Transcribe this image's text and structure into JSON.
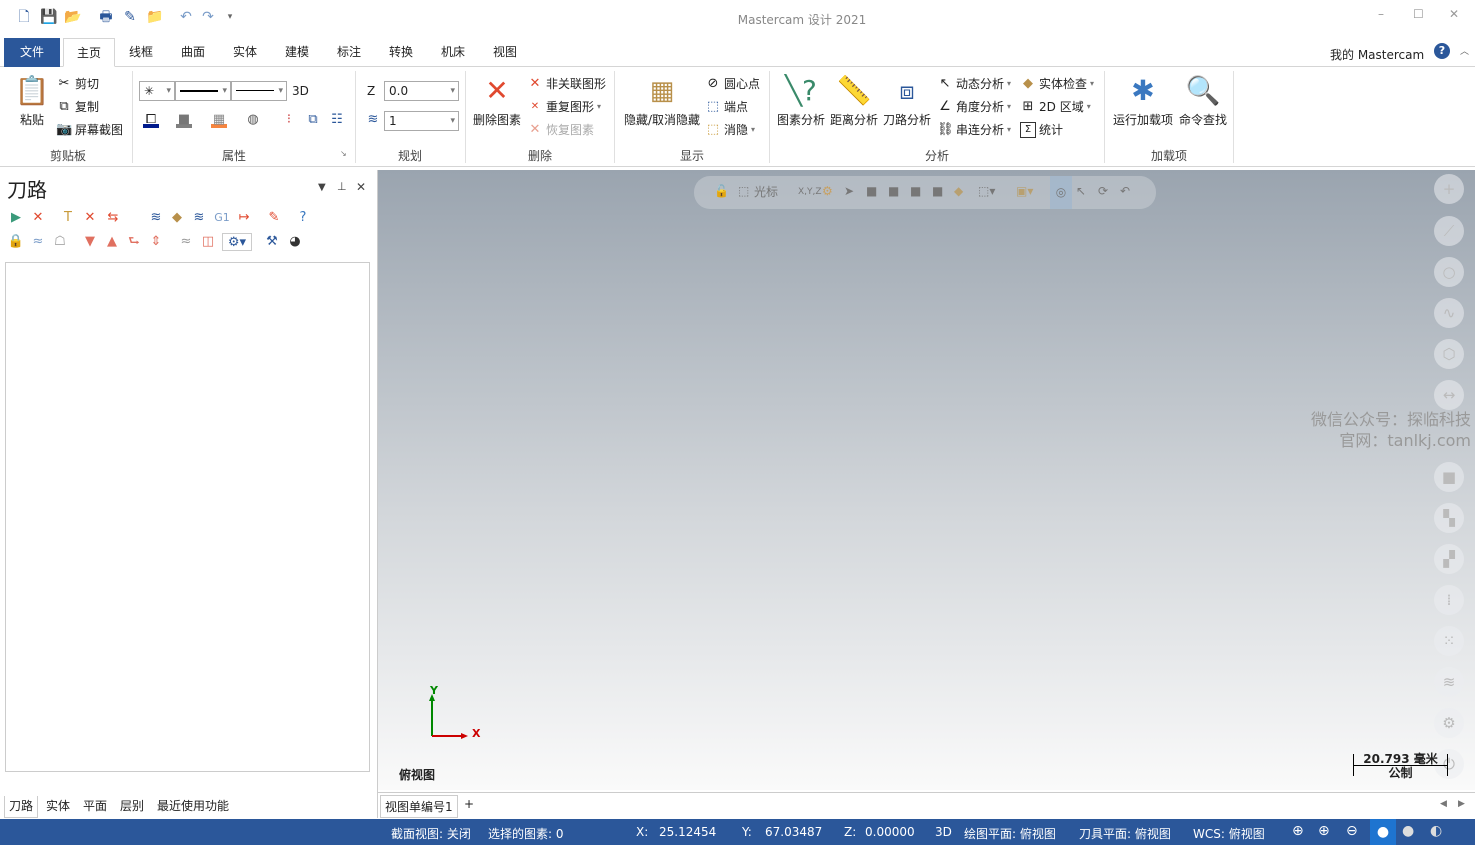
{
  "window": {
    "title": "Mastercam 设计 2021",
    "minimize": "–",
    "maximize": "☐",
    "close": "✕"
  },
  "tabs": [
    {
      "label": "文件"
    },
    {
      "label": "主页"
    },
    {
      "label": "线框"
    },
    {
      "label": "曲面"
    },
    {
      "label": "实体"
    },
    {
      "label": "建模"
    },
    {
      "label": "标注"
    },
    {
      "label": "转换"
    },
    {
      "label": "机床"
    },
    {
      "label": "视图"
    }
  ],
  "account": {
    "label": "我的 Mastercam",
    "help": "?"
  },
  "ribbon": {
    "clipboard": {
      "label": "剪贴板",
      "paste": "粘贴",
      "cut": "剪切",
      "copy": "复制",
      "screenshot": "屏幕截图"
    },
    "attributes": {
      "label": "属性",
      "point_style": "✳",
      "mode_3d": "3D"
    },
    "planning": {
      "label": "规划",
      "z_label": "Z",
      "z_value": "0.0",
      "level_value": "1"
    },
    "delete": {
      "label": "删除",
      "delete_entities": "删除图素",
      "unassociated": "非关联图形",
      "duplicate": "重复图形",
      "restore": "恢复图素"
    },
    "display": {
      "label": "显示",
      "hide_unhide": "隐藏/取消隐藏",
      "center_point": "圆心点",
      "endpoints": "端点",
      "blank": "消隐"
    },
    "analyze": {
      "label": "分析",
      "entity": "图素分析",
      "distance": "距离分析",
      "toolpath": "刀路分析",
      "dynamic": "动态分析",
      "angle": "角度分析",
      "chain": "串连分析",
      "solid_check": "实体检查",
      "area_2d": "2D 区域",
      "statistics": "统计"
    },
    "addins": {
      "label": "加载项",
      "run_addin": "运行加载项",
      "find_command": "命令查找"
    }
  },
  "panel": {
    "title": "刀路",
    "g1": "G1",
    "bottom_tabs": [
      {
        "label": "刀路"
      },
      {
        "label": "实体"
      },
      {
        "label": "平面"
      },
      {
        "label": "层别"
      },
      {
        "label": "最近使用功能"
      }
    ]
  },
  "viewport": {
    "selection_mode": "光标",
    "xyz": "X,Y,Z",
    "axis_x": "X",
    "axis_y": "Y",
    "view_name": "俯视图",
    "scale_value": "20.793 毫米",
    "scale_unit": "公制",
    "watermark_line1": "微信公众号：探临科技",
    "watermark_line2": "官网：tanlkj.com",
    "view_sheet_tab": "视图单编号1",
    "add_tab": "+"
  },
  "status": {
    "section_view": "截面视图: 关闭",
    "selected": "选择的图素: 0",
    "x_label": "X:",
    "x_value": "25.12454",
    "y_label": "Y:",
    "y_value": "67.03487",
    "z_label": "Z:",
    "z_value": "0.00000",
    "mode": "3D",
    "cplane": "绘图平面: 俯视图",
    "tplane": "刀具平面: 俯视图",
    "wcs": "WCS: 俯视图"
  },
  "colors": {
    "accent": "#2b579a",
    "delete_red": "#e0492f"
  }
}
